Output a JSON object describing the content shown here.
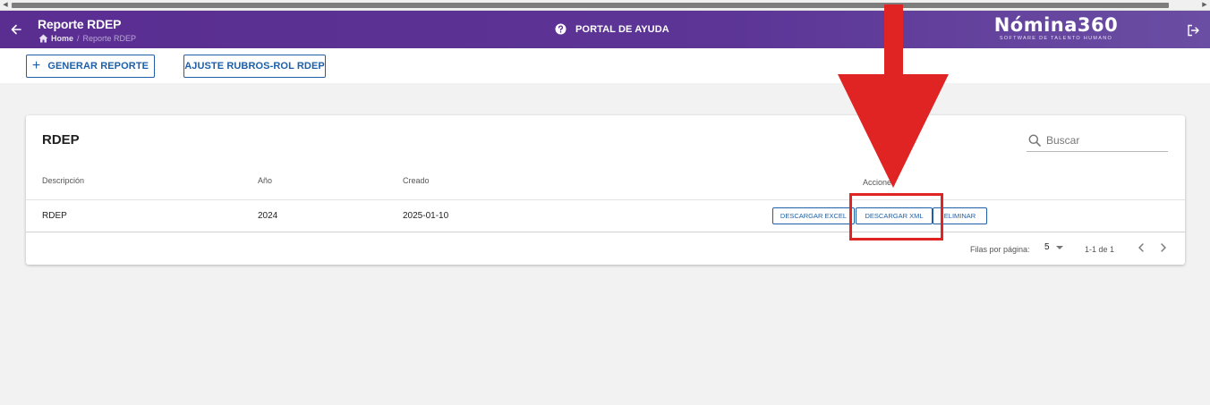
{
  "header": {
    "page_title": "Reporte RDEP",
    "breadcrumb": {
      "home": "Home",
      "separator": "/",
      "current": "Reporte RDEP"
    },
    "help_label": "PORTAL DE AYUDA",
    "brand_name": "Nómina360",
    "brand_tagline": "SOFTWARE DE TALENTO HUMANO",
    "icons": [
      "arrow-left-icon",
      "home-icon",
      "help-circle-icon",
      "logout-icon"
    ],
    "colors": {
      "bar": "#5a2d91",
      "text": "#ffffff"
    }
  },
  "toolbar": {
    "generar_label": "GENERAR REPORTE",
    "ajuste_label": "AJUSTE RUBROS-ROL RDEP",
    "accent": "#1e5fa8"
  },
  "card": {
    "title": "RDEP",
    "search_placeholder": "Buscar",
    "columns": [
      "Descripción",
      "Año",
      "Creado",
      "Acciones"
    ],
    "rows": [
      {
        "descripcion": "RDEP",
        "ano": "2024",
        "creado": "2025-01-10",
        "actions": [
          "DESCARGAR EXCEL",
          "DESCARGAR XML",
          "ELIMINAR"
        ]
      }
    ],
    "footer": {
      "rows_per_page_label": "Filas por página:",
      "rows_per_page_value": "5",
      "range": "1-1 de 1"
    }
  },
  "annotation": {
    "highlighted_action": "DESCARGAR XML",
    "color": "#e02424"
  }
}
